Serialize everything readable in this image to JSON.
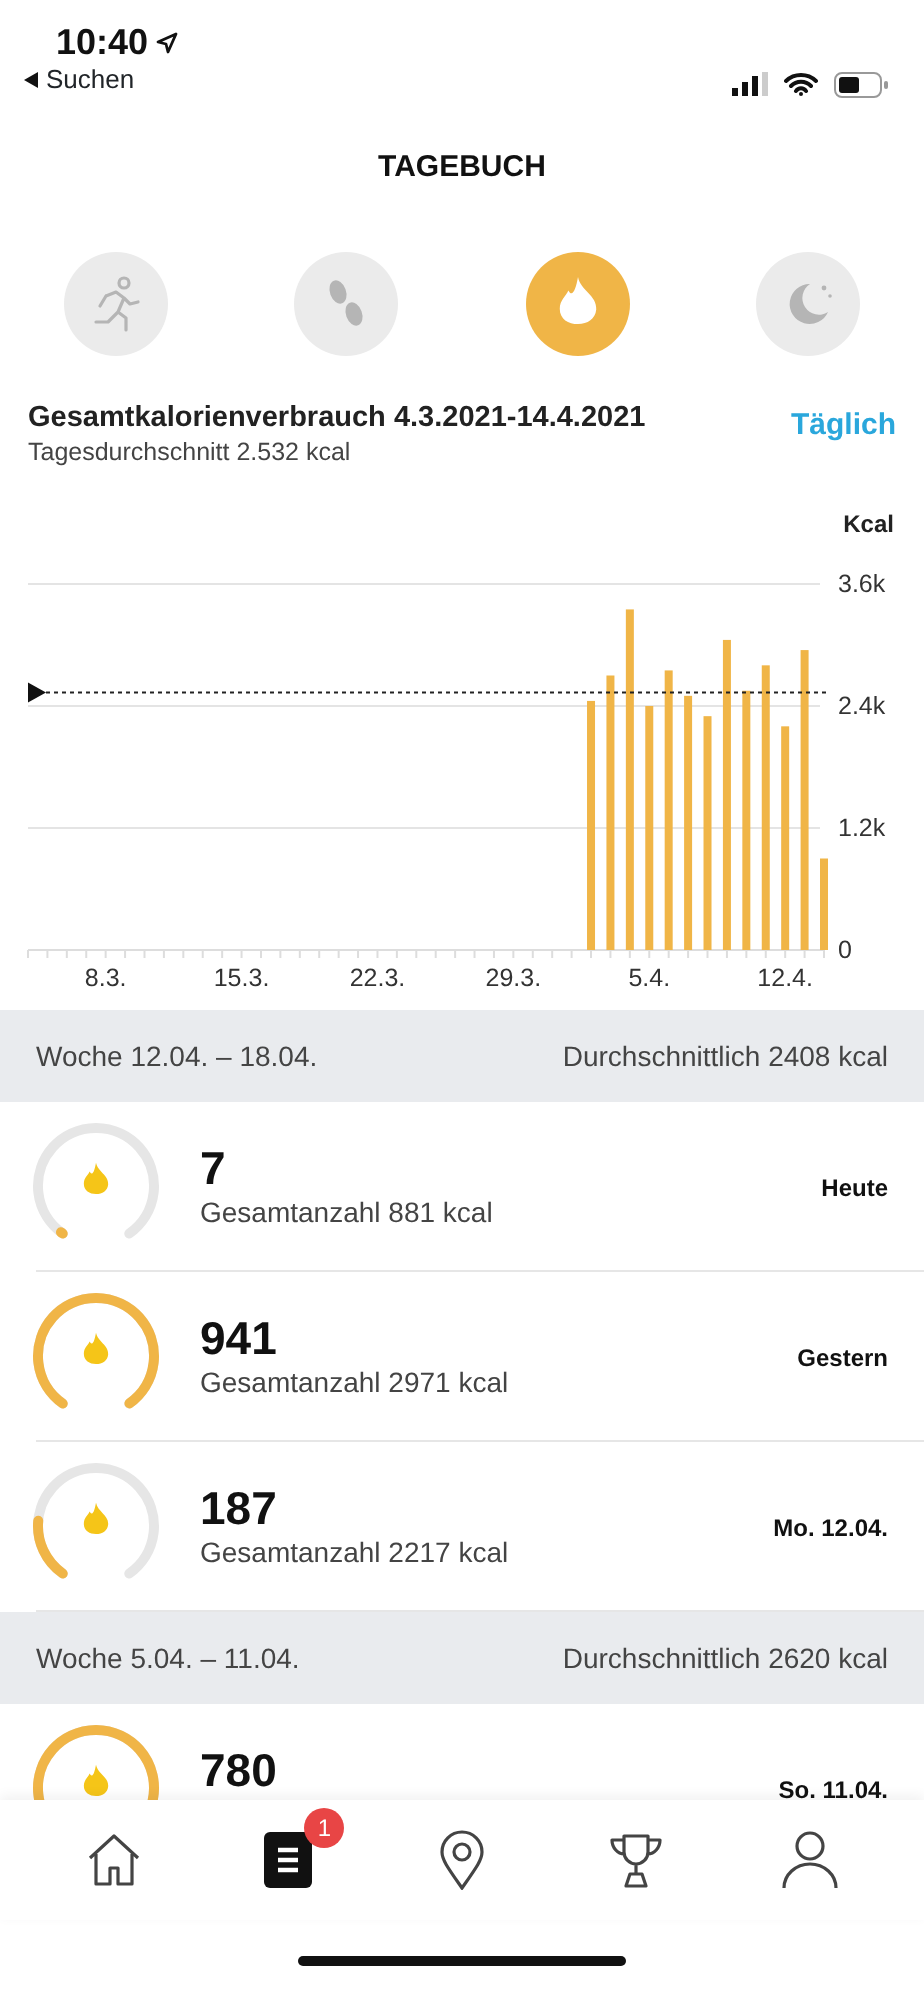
{
  "status_bar": {
    "time": "10:40",
    "back_label": "Suchen"
  },
  "title": "TAGEBUCH",
  "categories_tabs": [
    {
      "kind": "activity",
      "selected": false
    },
    {
      "kind": "steps",
      "selected": false
    },
    {
      "kind": "calories",
      "selected": true
    },
    {
      "kind": "sleep",
      "selected": false
    }
  ],
  "summary": {
    "title": "Gesamtkalorienverbrauch 4.3.2021-14.4.2021",
    "subtitle": "Tagesdurchschnitt 2.532 kcal",
    "period_button": "Täglich"
  },
  "chart": {
    "chart_data": {
      "type": "bar",
      "ylabel": "Kcal",
      "categories": [
        null,
        null,
        null,
        null,
        "8.3.",
        null,
        null,
        null,
        null,
        null,
        null,
        "15.3.",
        null,
        null,
        null,
        null,
        null,
        null,
        "22.3.",
        null,
        null,
        null,
        null,
        null,
        null,
        "29.3.",
        null,
        null,
        null,
        null,
        null,
        null,
        "5.4.",
        null,
        null,
        null,
        null,
        null,
        null,
        "12.4.",
        null,
        null
      ],
      "series": [
        {
          "color": "#f0b547",
          "values": [
            null,
            null,
            null,
            null,
            null,
            null,
            null,
            null,
            null,
            null,
            null,
            null,
            null,
            null,
            null,
            null,
            null,
            null,
            null,
            null,
            null,
            null,
            null,
            null,
            null,
            null,
            null,
            null,
            null,
            2450,
            2700,
            3350,
            2400,
            2750,
            2500,
            2300,
            3050,
            2550,
            2800,
            2200,
            2950,
            900
          ]
        }
      ],
      "ylim": [
        0,
        3600
      ],
      "yticks": [
        {
          "value": 0,
          "label": "0"
        },
        {
          "value": 1200,
          "label": "1.2k"
        },
        {
          "value": 2400,
          "label": "2.4k"
        },
        {
          "value": 3600,
          "label": "3.6k"
        }
      ],
      "ref_lines": [
        {
          "axis": "y",
          "value": 2532
        }
      ]
    }
  },
  "weeks": [
    {
      "label": "Woche 12.04. – 18.04.",
      "average": "Durchschnittlich 2408 kcal",
      "days": [
        {
          "value": "7",
          "total": "Gesamtanzahl 881 kcal",
          "date": "Heute"
        },
        {
          "value": "941",
          "total": "Gesamtanzahl 2971 kcal",
          "date": "Gestern"
        },
        {
          "value": "187",
          "total": "Gesamtanzahl 2217 kcal",
          "date": "Mo. 12.04."
        }
      ]
    },
    {
      "label": "Woche 5.04. – 11.04.",
      "average": "Durchschnittlich 2620 kcal",
      "days": [
        {
          "value": "780",
          "date": "So. 11.04."
        }
      ]
    }
  ],
  "tab_bar": [
    {
      "kind": "home",
      "selected": false
    },
    {
      "kind": "diary",
      "selected": true,
      "badge": "1"
    },
    {
      "kind": "map",
      "selected": false
    },
    {
      "kind": "trophy",
      "selected": false
    },
    {
      "kind": "profile",
      "selected": false
    }
  ]
}
